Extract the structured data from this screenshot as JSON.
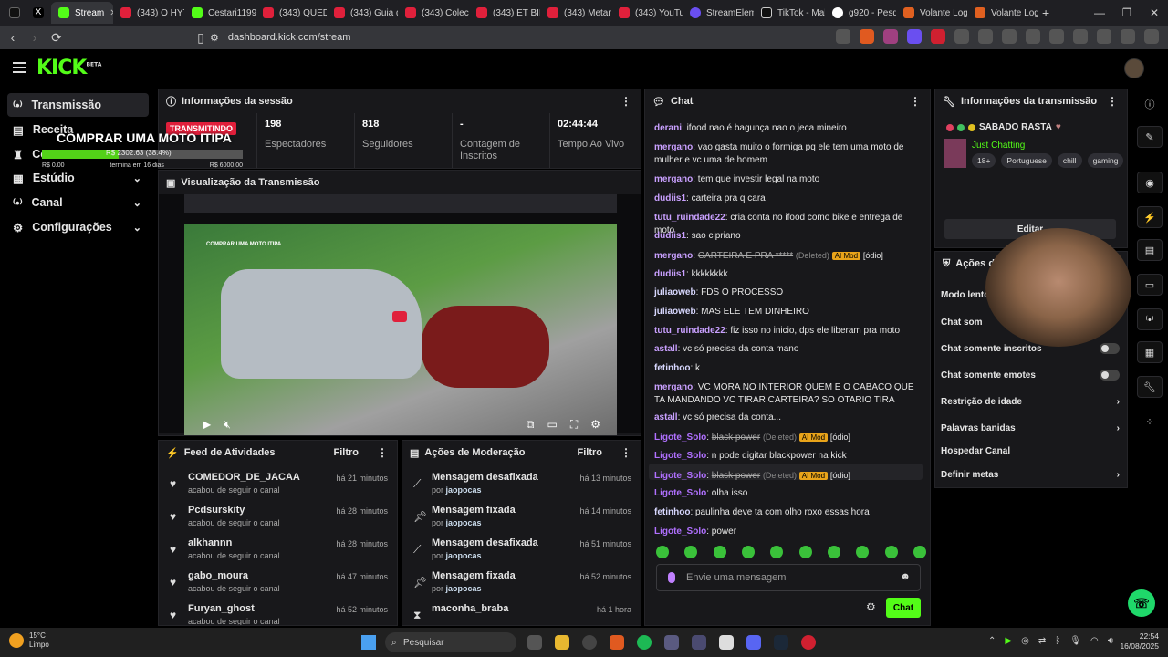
{
  "browser": {
    "tabs": [
      "Stream",
      "(343) O HYT…",
      "Cestari1199",
      "(343) QUEDA",
      "(343) Guia d…",
      "(343) Colecio…",
      "(343) ET BILU…",
      "(343) Metam…",
      "(343) YouTub…",
      "StreamElem…",
      "TikTok - Mak…",
      "g920 - Pesq…",
      "Volante Log…",
      "Volante Log…"
    ],
    "url": "dashboard.kick.com/stream"
  },
  "header": {
    "logo": "KICK",
    "beta": "BETA"
  },
  "sidebar": {
    "items": [
      {
        "icon": "broadcast-icon",
        "label": "Transmissão"
      },
      {
        "icon": "revenue-icon",
        "label": "Receita"
      },
      {
        "icon": "trophy-icon",
        "label": "Co"
      },
      {
        "icon": "studio-icon",
        "label": "Estúdio"
      },
      {
        "icon": "channel-icon",
        "label": "Canal"
      },
      {
        "icon": "settings-icon",
        "label": "Configurações"
      }
    ]
  },
  "overlay": {
    "title": "COMPRAR UMA MOTO ITIPA",
    "bar_text": "R$ 2302.63 (38.4%)",
    "progress_fraction": 0.384,
    "left_label": "R$ 0.00",
    "mid_label": "termina em 16 dias",
    "right_label": "R$ 6000.00"
  },
  "session": {
    "title": "Informações da sessão",
    "badge": "TRANSMITINDO",
    "stats": [
      {
        "value": "198",
        "label": "Espectadores"
      },
      {
        "value": "818",
        "label": "Seguidores"
      },
      {
        "value": "-",
        "label": "Contagem de Inscritos"
      },
      {
        "value": "02:44:44",
        "label": "Tempo Ao Vivo"
      }
    ]
  },
  "preview": {
    "title": "Visualização da Transmissão",
    "video_text": "COMPRAR UMA MOTO ITIPA"
  },
  "feed": {
    "title": "Feed de Atividades",
    "filter": "Filtro",
    "items": [
      {
        "name": "COMEDOR_DE_JACAA",
        "sub": "acabou de seguir o canal",
        "time": "há 21 minutos"
      },
      {
        "name": "Pcdsurskity",
        "sub": "acabou de seguir o canal",
        "time": "há 28 minutos"
      },
      {
        "name": "alkhannn",
        "sub": "acabou de seguir o canal",
        "time": "há 28 minutos"
      },
      {
        "name": "gabo_moura",
        "sub": "acabou de seguir o canal",
        "time": "há 47 minutos"
      },
      {
        "name": "Furyan_ghost",
        "sub": "acabou de seguir o canal",
        "time": "há 52 minutos"
      }
    ]
  },
  "moderation": {
    "title": "Ações de Moderação",
    "filter": "Filtro",
    "by": "por",
    "items": [
      {
        "icon": "unpin-icon",
        "name": "Mensagem desafixada",
        "who": "jaopocas",
        "time": "há 13 minutos"
      },
      {
        "icon": "pin-icon",
        "name": "Mensagem fixada",
        "who": "jaopocas",
        "time": "há 14 minutos"
      },
      {
        "icon": "unpin-icon",
        "name": "Mensagem desafixada",
        "who": "jaopocas",
        "time": "há 51 minutos"
      },
      {
        "icon": "pin-icon",
        "name": "Mensagem fixada",
        "who": "jaopocas",
        "time": "há 52 minutos"
      },
      {
        "icon": "hourglass-icon",
        "name": "maconha_braba",
        "who": "",
        "time": "há 1 hora"
      }
    ]
  },
  "chat": {
    "title": "Chat",
    "placeholder": "Envie uma mensagem",
    "send": "Chat",
    "deleted": "(Deleted)",
    "mod_badge": "AI Mod",
    "tag": "[ódio]",
    "messages": [
      {
        "user": "derani",
        "color": "#c9a0ff",
        "text": "ifood nao é bagunça nao o jeca mineiro"
      },
      {
        "user": "mergano",
        "color": "#c9a0ff",
        "text": "vao gasta muito o formiga pq ele tem uma moto de mulher e vc uma de homem"
      },
      {
        "user": "mergano",
        "color": "#c9a0ff",
        "text": "tem que investir legal na moto"
      },
      {
        "user": "dudiis1",
        "color": "#c9a0ff",
        "text": "carteira pra q cara"
      },
      {
        "user": "tutu_ruindade22",
        "color": "#c9a0ff",
        "text": "cria conta no ifood como bike e entrega de moto"
      },
      {
        "user": "dudiis1",
        "color": "#c9a0ff",
        "text": "sao cipriano"
      },
      {
        "user": "mergano",
        "color": "#c9a0ff",
        "text": "CARTEIRA E PRA *****",
        "deleted": true
      },
      {
        "user": "dudiis1",
        "color": "#c9a0ff",
        "text": "kkkkkkkk"
      },
      {
        "user": "juliaoweb",
        "color": "#d8d8ff",
        "text": "FDS O PROCESSO"
      },
      {
        "user": "juliaoweb",
        "color": "#d8d8ff",
        "text": "MAS ELE TEM DINHEIRO"
      },
      {
        "user": "tutu_ruindade22",
        "color": "#c9a0ff",
        "text": "fiz isso no inicio, dps ele liberam pra moto"
      },
      {
        "user": "astall",
        "color": "#c9a0ff",
        "text": "vc só precisa da conta mano"
      },
      {
        "user": "fetinhoo",
        "color": "#d8d8ff",
        "text": "k"
      },
      {
        "user": "mergano",
        "color": "#c9a0ff",
        "text": "VC MORA NO INTERIOR QUEM E O CABACO QUE TA MANDANDO VC TIRAR CARTEIRA? SO OTARIO TIRA"
      },
      {
        "user": "astall",
        "color": "#c9a0ff",
        "text": "vc só precisa da conta..."
      },
      {
        "user": "Ligote_Solo",
        "color": "#b070ff",
        "text": "black power",
        "deleted": true
      },
      {
        "user": "Ligote_Solo",
        "color": "#b070ff",
        "text": "n pode digitar blackpower na kick"
      },
      {
        "user": "Ligote_Solo",
        "color": "#b070ff",
        "text": "black power",
        "deleted": true
      },
      {
        "user": "Ligote_Solo",
        "color": "#b070ff",
        "text": "olha isso"
      },
      {
        "user": "fetinhoo",
        "color": "#d8d8ff",
        "text": "paulinha deve ta com olho roxo essas hora"
      },
      {
        "user": "Ligote_Solo",
        "color": "#b070ff",
        "text": "power"
      }
    ]
  },
  "info": {
    "title": "Informações da transmissão",
    "stream_title": "SABADO RASTA",
    "category": "Just Chatting",
    "tags": [
      "18+",
      "Portuguese",
      "chill",
      "gaming"
    ],
    "edit": "Editar"
  },
  "actions": {
    "title": "Ações do",
    "items": [
      {
        "label": "Modo lento",
        "kind": "chevron"
      },
      {
        "label": "Chat som",
        "kind": "none"
      },
      {
        "label": "Chat somente inscritos",
        "kind": "toggle"
      },
      {
        "label": "Chat somente emotes",
        "kind": "toggle"
      },
      {
        "label": "Restrição de idade",
        "kind": "chevron"
      },
      {
        "label": "Palavras banidas",
        "kind": "chevron"
      },
      {
        "label": "Hospedar Canal",
        "kind": "none"
      },
      {
        "label": "Definir metas",
        "kind": "chevron"
      }
    ]
  },
  "taskbar": {
    "temp": "15°C",
    "weather": "Limpo",
    "search": "Pesquisar",
    "time": "22:54",
    "date": "16/08/2025"
  }
}
